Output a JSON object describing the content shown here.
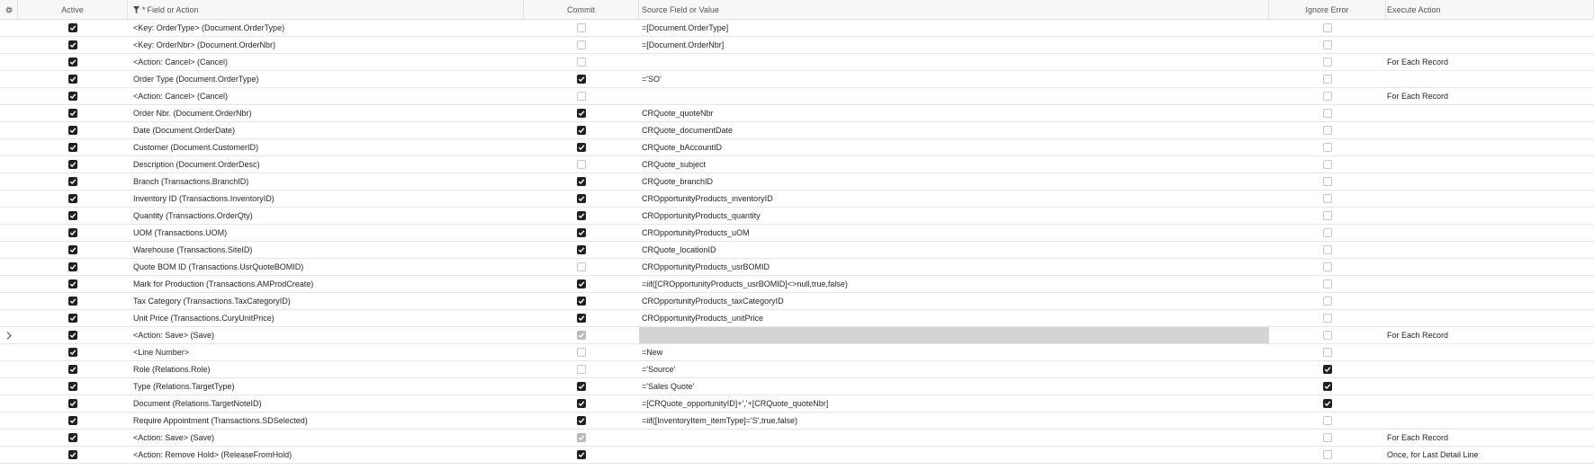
{
  "columns": {
    "active": "Active",
    "field": "Field or Action",
    "commit": "Commit",
    "source": "Source Field or Value",
    "ignore": "Ignore Error",
    "execute": "Execute Action"
  },
  "rows": [
    {
      "active": true,
      "field": "<Key: OrderType> (Document.OrderType)",
      "commit": false,
      "commit_disabled": false,
      "source": "=[Document.OrderType]",
      "ignore": false,
      "execute": ""
    },
    {
      "active": true,
      "field": "<Key: OrderNbr> (Document.OrderNbr)",
      "commit": false,
      "commit_disabled": false,
      "source": "=[Document.OrderNbr]",
      "ignore": false,
      "execute": ""
    },
    {
      "active": true,
      "field": "<Action: Cancel> (Cancel)",
      "commit": false,
      "commit_disabled": false,
      "source": "",
      "ignore": false,
      "execute": "For Each Record"
    },
    {
      "active": true,
      "field": "Order Type (Document.OrderType)",
      "commit": true,
      "commit_disabled": false,
      "source": "='SO'",
      "ignore": false,
      "execute": ""
    },
    {
      "active": true,
      "field": "<Action: Cancel> (Cancel)",
      "commit": false,
      "commit_disabled": false,
      "source": "",
      "ignore": false,
      "execute": "For Each Record"
    },
    {
      "active": true,
      "field": "Order Nbr. (Document.OrderNbr)",
      "commit": true,
      "commit_disabled": false,
      "source": "CRQuote_quoteNbr",
      "ignore": false,
      "execute": ""
    },
    {
      "active": true,
      "field": "Date (Document.OrderDate)",
      "commit": true,
      "commit_disabled": false,
      "source": "CRQuote_documentDate",
      "ignore": false,
      "execute": ""
    },
    {
      "active": true,
      "field": "Customer (Document.CustomerID)",
      "commit": true,
      "commit_disabled": false,
      "source": "CRQuote_bAccountID",
      "ignore": false,
      "execute": ""
    },
    {
      "active": true,
      "field": "Description (Document.OrderDesc)",
      "commit": false,
      "commit_disabled": false,
      "source": "CRQuote_subject",
      "ignore": false,
      "execute": ""
    },
    {
      "active": true,
      "field": "Branch (Transactions.BranchID)",
      "commit": true,
      "commit_disabled": false,
      "source": "CRQuote_branchID",
      "ignore": false,
      "execute": ""
    },
    {
      "active": true,
      "field": "Inventory ID (Transactions.InventoryID)",
      "commit": true,
      "commit_disabled": false,
      "source": "CROpportunityProducts_inventoryID",
      "ignore": false,
      "execute": ""
    },
    {
      "active": true,
      "field": "Quantity (Transactions.OrderQty)",
      "commit": true,
      "commit_disabled": false,
      "source": "CROpportunityProducts_quantity",
      "ignore": false,
      "execute": ""
    },
    {
      "active": true,
      "field": "UOM (Transactions.UOM)",
      "commit": true,
      "commit_disabled": false,
      "source": "CROpportunityProducts_uOM",
      "ignore": false,
      "execute": ""
    },
    {
      "active": true,
      "field": "Warehouse (Transactions.SiteID)",
      "commit": true,
      "commit_disabled": false,
      "source": "CRQuote_locationID",
      "ignore": false,
      "execute": ""
    },
    {
      "active": true,
      "field": "Quote BOM ID (Transactions.UsrQuoteBOMID)",
      "commit": false,
      "commit_disabled": false,
      "source": "CROpportunityProducts_usrBOMID",
      "ignore": false,
      "execute": ""
    },
    {
      "active": true,
      "field": "Mark for Production (Transactions.AMProdCreate)",
      "commit": true,
      "commit_disabled": false,
      "source": "=iif([CROpportunityProducts_usrBOMID]<>null,true,false)",
      "ignore": false,
      "execute": ""
    },
    {
      "active": true,
      "field": "Tax Category (Transactions.TaxCategoryID)",
      "commit": true,
      "commit_disabled": false,
      "source": "CROpportunityProducts_taxCategoryID",
      "ignore": false,
      "execute": ""
    },
    {
      "active": true,
      "field": "Unit Price (Transactions.CuryUnitPrice)",
      "commit": true,
      "commit_disabled": false,
      "source": "CROpportunityProducts_unitPrice",
      "ignore": false,
      "execute": ""
    },
    {
      "active": true,
      "field": "<Action: Save> (Save)",
      "commit": true,
      "commit_disabled": true,
      "source": "",
      "ignore": false,
      "execute": "For Each Record",
      "selected": true
    },
    {
      "active": true,
      "field": "<Line Number>",
      "commit": false,
      "commit_disabled": false,
      "source": "=New",
      "ignore": false,
      "execute": ""
    },
    {
      "active": true,
      "field": "Role (Relations.Role)",
      "commit": false,
      "commit_disabled": false,
      "source": "='Source'",
      "ignore": true,
      "execute": ""
    },
    {
      "active": true,
      "field": "Type (Relations.TargetType)",
      "commit": true,
      "commit_disabled": false,
      "source": "='Sales Quote'",
      "ignore": true,
      "execute": ""
    },
    {
      "active": true,
      "field": "Document (Relations.TargetNoteID)",
      "commit": true,
      "commit_disabled": false,
      "source": "=[CRQuote_opportunityID]+','+[CRQuote_quoteNbr]",
      "ignore": true,
      "execute": ""
    },
    {
      "active": true,
      "field": "Require Appointment (Transactions.SDSelected)",
      "commit": true,
      "commit_disabled": false,
      "source": "=iif([InventoryItem_itemType]='S',true,false)",
      "ignore": false,
      "execute": ""
    },
    {
      "active": true,
      "field": "<Action: Save> (Save)",
      "commit": true,
      "commit_disabled": true,
      "source": "",
      "ignore": false,
      "execute": "For Each Record"
    },
    {
      "active": true,
      "field": "<Action: Remove Hold> (ReleaseFromHold)",
      "commit": true,
      "commit_disabled": false,
      "source": "",
      "ignore": false,
      "execute": "Once, for Last Detail Line"
    }
  ]
}
